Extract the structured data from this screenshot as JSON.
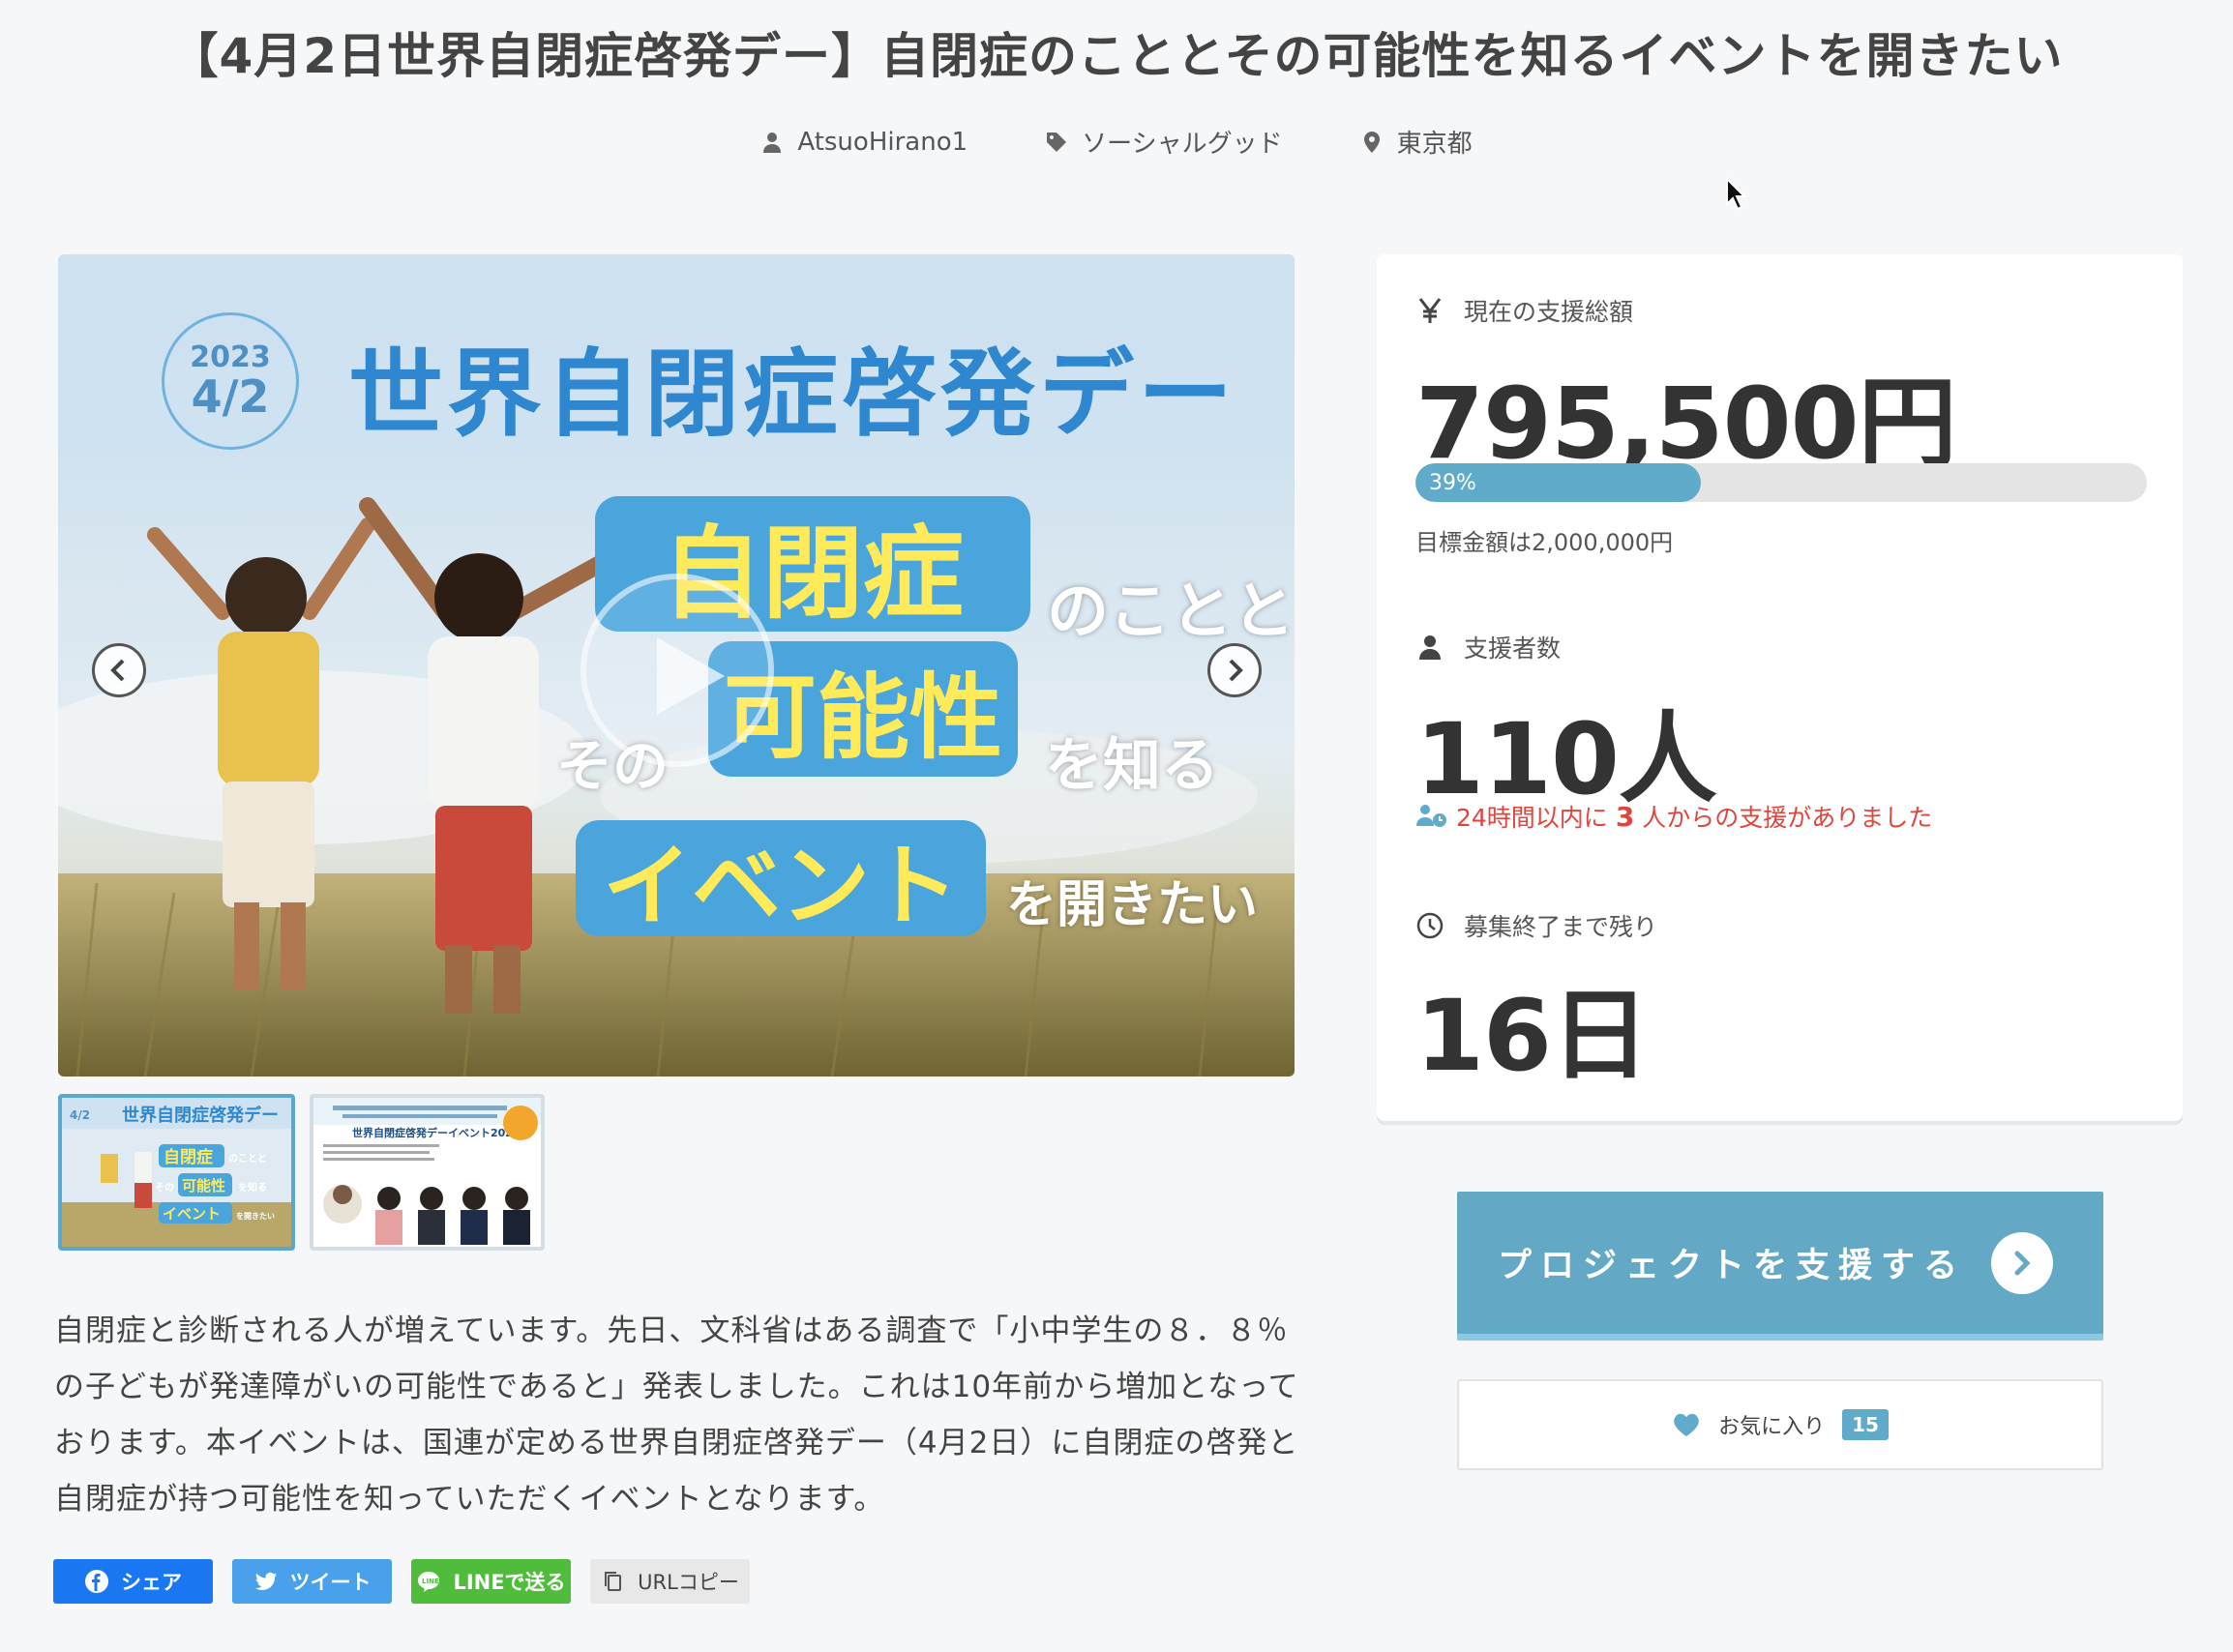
{
  "project": {
    "title": "【4月2日世界自閉症啓発デー】自閉症のこととその可能性を知るイベントを開きたい",
    "author": "AtsuoHirano1",
    "category": "ソーシャルグッド",
    "location": "東京都"
  },
  "hero": {
    "logo_year": "2023",
    "logo_date": "4/2",
    "heading": "世界自閉症啓発デー",
    "pill_1": "自閉症",
    "word_1": "のことと",
    "word_2": "その",
    "pill_2": "可能性",
    "word_3": "を知る",
    "pill_3": "イベント",
    "word_4": "を開きたい",
    "prev_icon": "chevron-left-icon",
    "next_icon": "chevron-right-icon",
    "play_icon": "play-icon"
  },
  "thumbnails": {
    "thumb_1": {
      "heading": "世界自閉症啓発デー",
      "logo_date": "4/2",
      "pill_1": "自閉症",
      "word_1": "のことと",
      "word_2": "その",
      "pill_2": "可能性",
      "word_3": "を知る",
      "pill_3": "イベント",
      "word_4": "を開きたい"
    },
    "thumb_2": {
      "title": "世界自閉症啓発デーイベント2023"
    }
  },
  "description": "自閉症と診断される人が増えています。先日、文科省はある調査で「小中学生の８．８％の子どもが発達障がいの可能性であると」発表しました。これは10年前から増加となっております。本イベントは、国連が定める世界自閉症啓発デー（4月2日）に自閉症の啓発と自閉症が持つ可能性を知っていただくイベントとなります。",
  "share": {
    "facebook": "シェア",
    "twitter": "ツイート",
    "line": "LINEで送る",
    "url_copy": "URLコピー"
  },
  "stats": {
    "amount_label": "現在の支援総額",
    "amount": "795,500円",
    "progress_label": "39%",
    "progress_fraction": 0.39,
    "goal": "目標金額は2,000,000円",
    "supporters_label": "支援者数",
    "supporters": "110人",
    "recent_prefix": "24時間以内に",
    "recent_count": "3",
    "recent_suffix": "人からの支援がありました",
    "remaining_label": "募集終了まで残り",
    "remaining": "16日"
  },
  "actions": {
    "support": "プロジェクトを支援する",
    "favorite": "お気に入り",
    "favorite_count": "15"
  },
  "colors": {
    "accent": "#63a9c6",
    "progress": "#5fabc9",
    "alert": "#e0453b",
    "facebook": "#1a77f2",
    "twitter": "#4aa1eb",
    "line": "#4fbd3b"
  }
}
